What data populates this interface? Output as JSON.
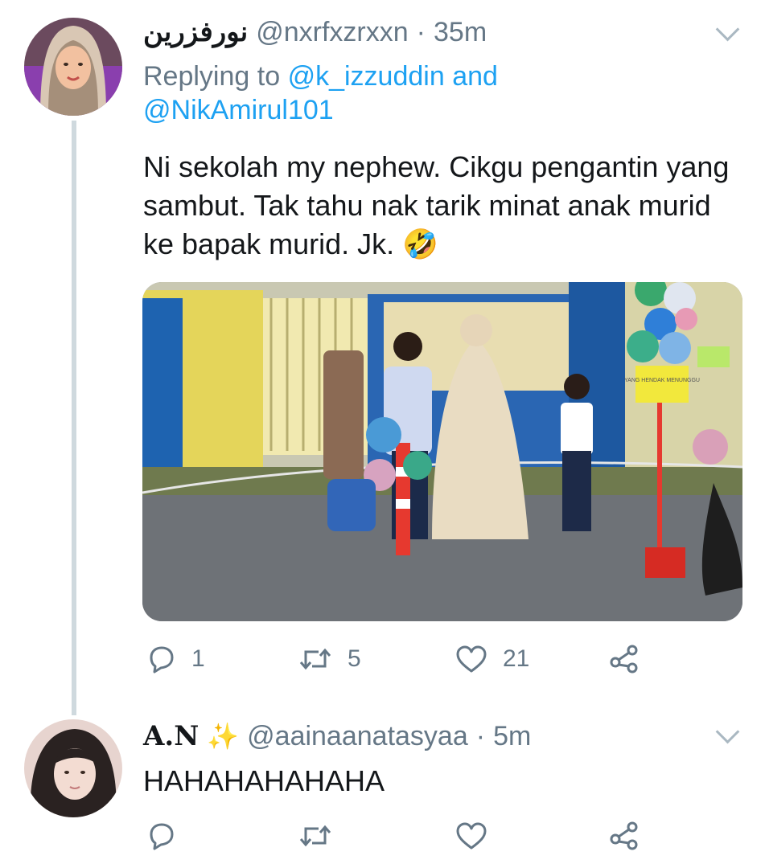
{
  "tweet1": {
    "display_name": "نورفزرين",
    "handle": "@nxrfxzrxxn",
    "time": "35m",
    "separator": "·",
    "replying_prefix": "Replying to",
    "replying_to_1": "@k_izzuddin",
    "replying_and": "and",
    "replying_to_2": "@NikAmirul101",
    "text": "Ni sekolah my nephew. Cikgu pengantin yang sambut. Tak tahu nak tarik minat anak murid ke bapak murid. Jk.",
    "emoji": "🤣",
    "sign_text": "YANG HENDAK MENUNGGU",
    "reply_count": "1",
    "retweet_count": "5",
    "like_count": "21"
  },
  "tweet2": {
    "display_name": "A.N",
    "sparkle": "✨",
    "handle": "@aainaanatasyaa",
    "time": "5m",
    "separator": "·",
    "text": "HAHAHAHAHAHA"
  },
  "colors": {
    "link": "#1da1f2",
    "muted": "#657786",
    "text": "#14171a",
    "thread_line": "#cfd9de"
  },
  "icons": [
    "reply-icon",
    "retweet-icon",
    "like-icon",
    "share-icon",
    "chevron-down-icon"
  ]
}
